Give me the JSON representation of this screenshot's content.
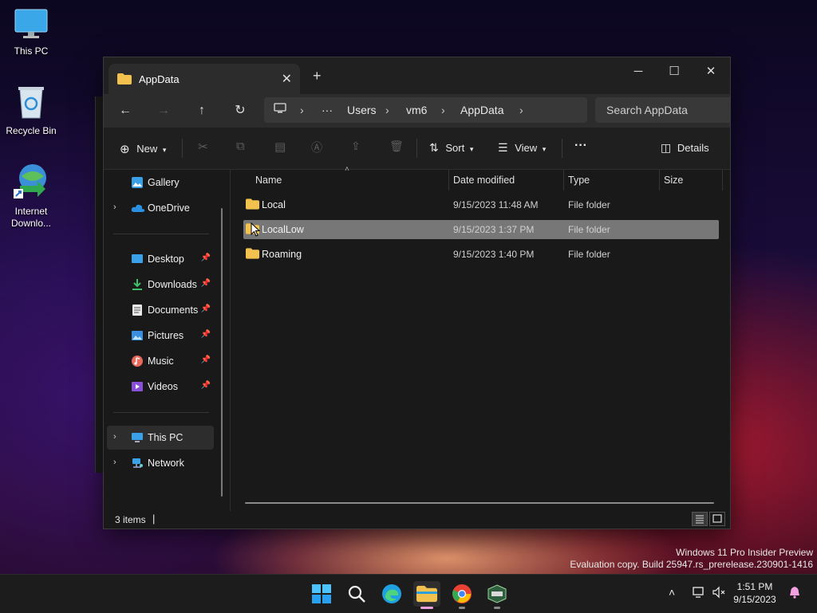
{
  "desktop": {
    "icons": [
      {
        "label": "This PC"
      },
      {
        "label": "Recycle Bin"
      },
      {
        "label": "Internet Downlo..."
      }
    ]
  },
  "window": {
    "tab_title": "AppData",
    "new_tab_glyph": "+",
    "controls": {
      "minimize": "─",
      "maximize": "☐",
      "close": "✕"
    }
  },
  "navigation": {
    "breadcrumb": [
      "Users",
      "vm6",
      "AppData"
    ],
    "more_glyph": "···",
    "search_placeholder": "Search AppData"
  },
  "commands": {
    "new_label": "New",
    "sort_label": "Sort",
    "view_label": "View",
    "more_glyph": "···",
    "details_label": "Details"
  },
  "sidebar": {
    "top": [
      {
        "label": "Gallery",
        "icon": "gallery-icon"
      },
      {
        "label": "OneDrive",
        "icon": "cloud-icon"
      }
    ],
    "quick_access": [
      {
        "label": "Desktop",
        "icon": "desktop-icon"
      },
      {
        "label": "Downloads",
        "icon": "download-icon"
      },
      {
        "label": "Documents",
        "icon": "document-icon"
      },
      {
        "label": "Pictures",
        "icon": "picture-icon"
      },
      {
        "label": "Music",
        "icon": "music-icon"
      },
      {
        "label": "Videos",
        "icon": "video-icon"
      }
    ],
    "bottom": [
      {
        "label": "This PC",
        "icon": "computer-icon"
      },
      {
        "label": "Network",
        "icon": "network-icon"
      }
    ]
  },
  "file_list": {
    "columns": [
      "Name",
      "Date modified",
      "Type",
      "Size"
    ],
    "rows": [
      {
        "name": "Local",
        "date": "9/15/2023 11:48 AM",
        "type": "File folder"
      },
      {
        "name": "LocalLow",
        "date": "9/15/2023 1:37 PM",
        "type": "File folder"
      },
      {
        "name": "Roaming",
        "date": "9/15/2023 1:40 PM",
        "type": "File folder"
      }
    ]
  },
  "status": {
    "item_count": "3 items"
  },
  "watermark": {
    "line1": "Windows 11 Pro Insider Preview",
    "line2": "Evaluation copy. Build 25947.rs_prerelease.230901-1416"
  },
  "clock": {
    "time": "1:51 PM",
    "date": "9/15/2023"
  },
  "colors": {
    "folder": "#f2c14e",
    "accent": "#4cc2ff",
    "selection": "#777777"
  }
}
